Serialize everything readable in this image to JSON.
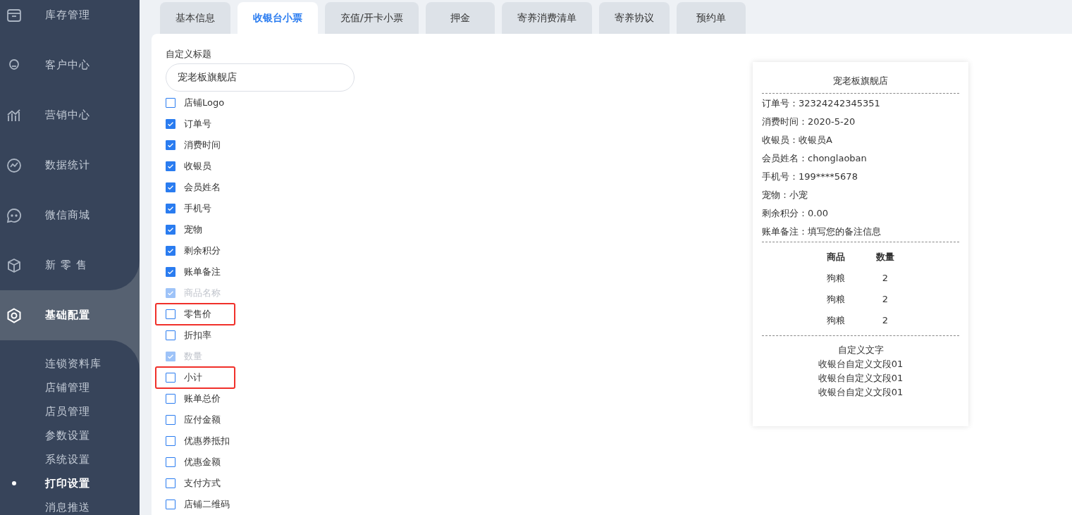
{
  "sidebar": {
    "items": [
      {
        "label": "库存管理",
        "selected": false
      },
      {
        "label": "客户中心",
        "selected": false
      },
      {
        "label": "营销中心",
        "selected": false
      },
      {
        "label": "数据统计",
        "selected": false
      },
      {
        "label": "微信商城",
        "selected": false
      },
      {
        "label": "新 零 售",
        "selected": false
      },
      {
        "label": "基础配置",
        "selected": true
      }
    ],
    "subitems": [
      {
        "label": "连锁资料库",
        "selected": false
      },
      {
        "label": "店铺管理",
        "selected": false
      },
      {
        "label": "店员管理",
        "selected": false
      },
      {
        "label": "参数设置",
        "selected": false
      },
      {
        "label": "系统设置",
        "selected": false
      },
      {
        "label": "打印设置",
        "selected": true
      },
      {
        "label": "消息推送",
        "selected": false
      }
    ]
  },
  "tabs": [
    {
      "label": "基本信息",
      "selected": false
    },
    {
      "label": "收银台小票",
      "selected": true
    },
    {
      "label": "充值/开卡小票",
      "selected": false
    },
    {
      "label": "押金",
      "selected": false
    },
    {
      "label": "寄养消费清单",
      "selected": false
    },
    {
      "label": "寄养协议",
      "selected": false
    },
    {
      "label": "预约单",
      "selected": false
    }
  ],
  "form": {
    "title_label": "自定义标题",
    "title_value": "宠老板旗舰店",
    "fields": [
      {
        "label": "店铺Logo",
        "checked": false,
        "disabled": false,
        "highlighted": false
      },
      {
        "label": "订单号",
        "checked": true,
        "disabled": false,
        "highlighted": false
      },
      {
        "label": "消费时间",
        "checked": true,
        "disabled": false,
        "highlighted": false
      },
      {
        "label": "收银员",
        "checked": true,
        "disabled": false,
        "highlighted": false
      },
      {
        "label": "会员姓名",
        "checked": true,
        "disabled": false,
        "highlighted": false
      },
      {
        "label": "手机号",
        "checked": true,
        "disabled": false,
        "highlighted": false
      },
      {
        "label": "宠物",
        "checked": true,
        "disabled": false,
        "highlighted": false
      },
      {
        "label": "剩余积分",
        "checked": true,
        "disabled": false,
        "highlighted": false
      },
      {
        "label": "账单备注",
        "checked": true,
        "disabled": false,
        "highlighted": false
      },
      {
        "label": "商品名称",
        "checked": true,
        "disabled": true,
        "highlighted": false
      },
      {
        "label": "零售价",
        "checked": false,
        "disabled": false,
        "highlighted": true
      },
      {
        "label": "折扣率",
        "checked": false,
        "disabled": false,
        "highlighted": false
      },
      {
        "label": "数量",
        "checked": true,
        "disabled": true,
        "highlighted": false
      },
      {
        "label": "小计",
        "checked": false,
        "disabled": false,
        "highlighted": true
      },
      {
        "label": "账单总价",
        "checked": false,
        "disabled": false,
        "highlighted": false
      },
      {
        "label": "应付金额",
        "checked": false,
        "disabled": false,
        "highlighted": false
      },
      {
        "label": "优惠券抵扣",
        "checked": false,
        "disabled": false,
        "highlighted": false
      },
      {
        "label": "优惠金额",
        "checked": false,
        "disabled": false,
        "highlighted": false
      },
      {
        "label": "支付方式",
        "checked": false,
        "disabled": false,
        "highlighted": false
      },
      {
        "label": "店铺二维码",
        "checked": false,
        "disabled": false,
        "highlighted": false
      }
    ]
  },
  "receipt": {
    "title": "宠老板旗舰店",
    "lines": [
      "订单号：32324242345351",
      "消费时间：2020-5-20",
      "收银员：收银员A",
      "会员姓名：chonglaoban",
      "手机号：199****5678",
      "宠物：小宠",
      "剩余积分：0.00",
      "账单备注：填写您的备注信息"
    ],
    "columns": [
      "商品",
      "数量"
    ],
    "rows": [
      [
        "狗粮",
        "2"
      ],
      [
        "狗粮",
        "2"
      ],
      [
        "狗粮",
        "2"
      ]
    ],
    "footer": [
      "自定义文字",
      "收银台自定义文段01",
      "收银台自定义文段01",
      "收银台自定义文段01"
    ]
  }
}
